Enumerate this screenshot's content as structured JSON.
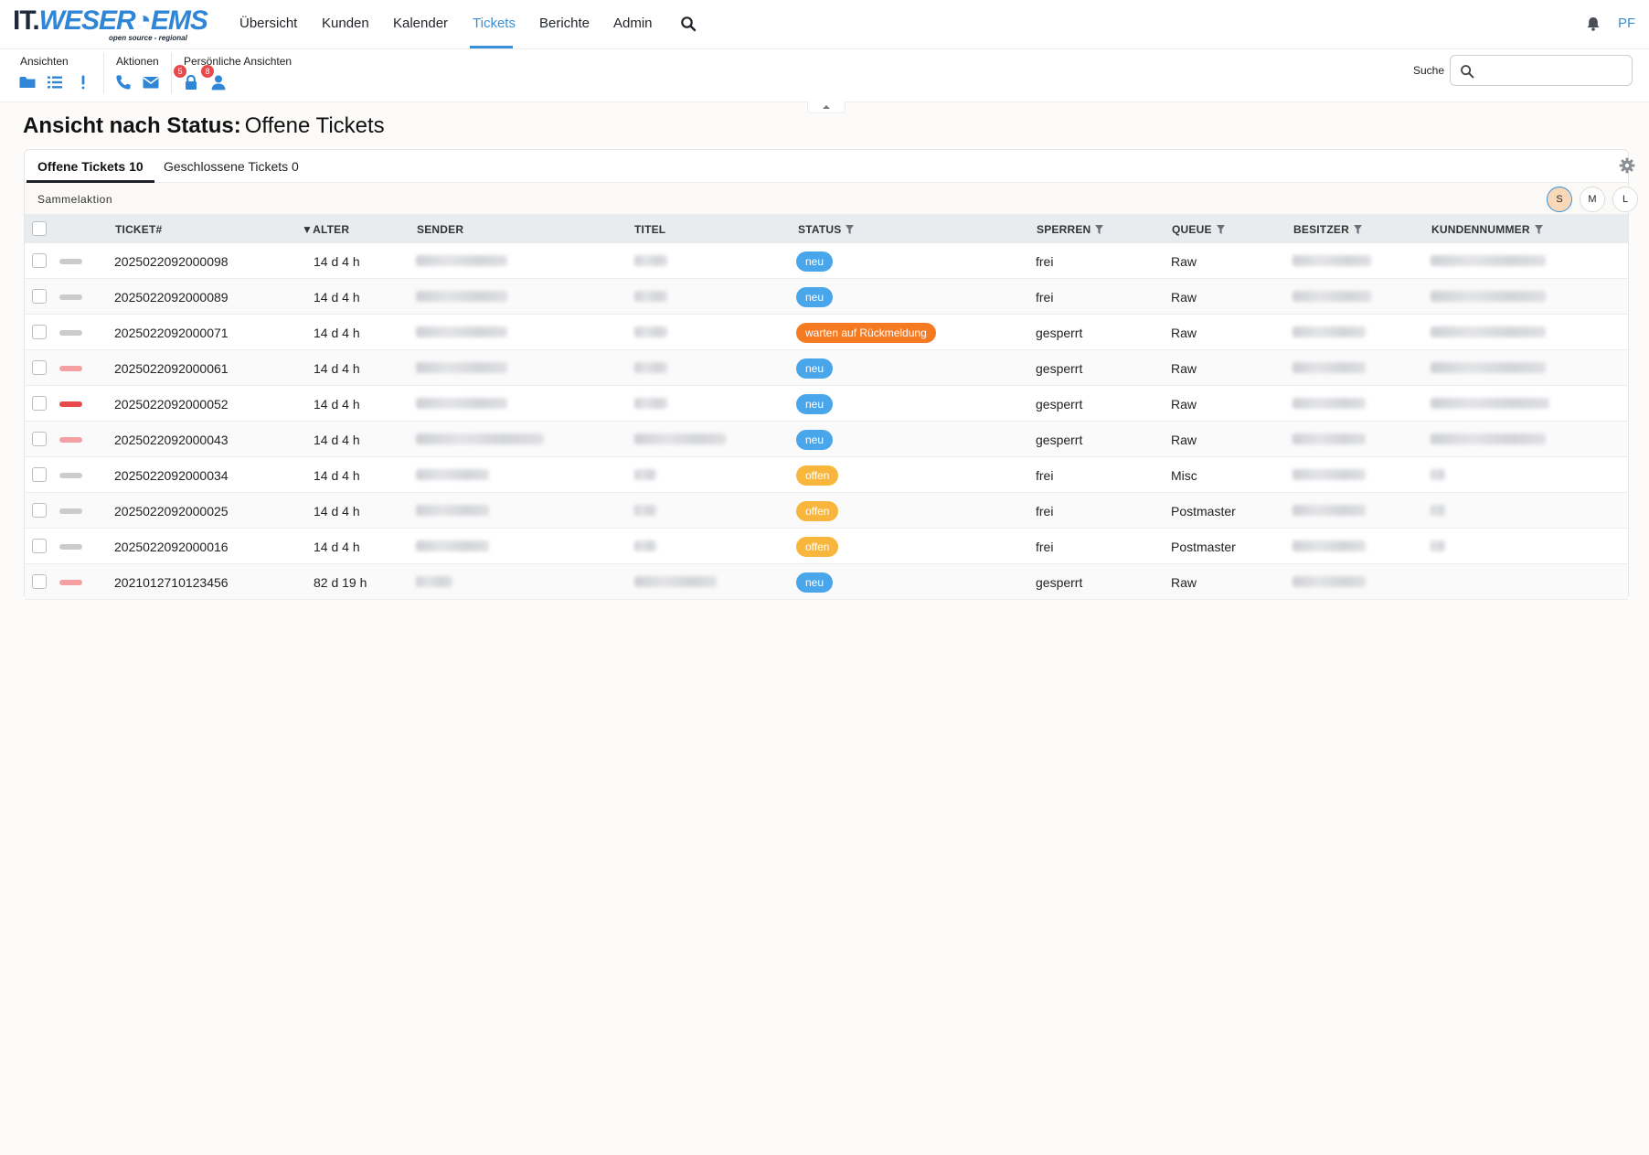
{
  "logo": {
    "part1": "IT.",
    "part2": "WESER",
    "part3": "EMS",
    "tagline": "open source - regional"
  },
  "nav": {
    "items": [
      {
        "label": "Übersicht"
      },
      {
        "label": "Kunden"
      },
      {
        "label": "Kalender"
      },
      {
        "label": "Tickets"
      },
      {
        "label": "Berichte"
      },
      {
        "label": "Admin"
      }
    ],
    "active": "Tickets",
    "search_icon": "search-icon",
    "bell_icon": "bell-icon",
    "user_initials": "PF"
  },
  "toolbar": {
    "views_label": "Ansichten",
    "actions_label": "Aktionen",
    "personal_label": "Persönliche Ansichten",
    "locked_badge": "5",
    "owned_badge": "8",
    "search_label": "Suche",
    "search_value": "",
    "search_placeholder": "",
    "icons": [
      "folder-icon",
      "list-icon",
      "exclamation-icon",
      "phone-icon",
      "envelope-icon",
      "lock-icon",
      "user-icon"
    ]
  },
  "heading": {
    "bold": "Ansicht nach Status:",
    "normal": "Offene Tickets"
  },
  "tabs": [
    {
      "label": "Offene Tickets 10"
    },
    {
      "label": "Geschlossene Tickets 0"
    }
  ],
  "bulk_action_label": "Sammelaktion",
  "size_buttons": [
    "S",
    "M",
    "L"
  ],
  "active_size": "S",
  "columns": [
    "TICKET#",
    "ALTER",
    "SENDER",
    "TITEL",
    "STATUS",
    "SPERREN",
    "QUEUE",
    "BESITZER",
    "KUNDENNUMMER"
  ],
  "sort_indicator": "▼",
  "colors": {
    "accent": "#3a8fd9",
    "status_neu": "#4aa6ea",
    "status_warten": "#f57a22",
    "status_offen": "#f8b73c",
    "prio_normal": "#cccccc",
    "prio_high": "#f4a0a2",
    "prio_very_high": "#e8494b"
  },
  "tickets": [
    {
      "number": "2025022092000098",
      "age": "14 d 4 h",
      "sender": "",
      "title": "",
      "status": "neu",
      "status_type": "neu",
      "lock": "frei",
      "queue": "Raw",
      "owner": "",
      "customer_id": "",
      "priority": "normal"
    },
    {
      "number": "2025022092000089",
      "age": "14 d 4 h",
      "sender": "",
      "title": "",
      "status": "neu",
      "status_type": "neu",
      "lock": "frei",
      "queue": "Raw",
      "owner": "",
      "customer_id": "",
      "priority": "normal"
    },
    {
      "number": "2025022092000071",
      "age": "14 d 4 h",
      "sender": "",
      "title": "",
      "status": "warten auf Rückmeldung",
      "status_type": "warten",
      "lock": "gesperrt",
      "queue": "Raw",
      "owner": "",
      "customer_id": "",
      "priority": "normal"
    },
    {
      "number": "2025022092000061",
      "age": "14 d 4 h",
      "sender": "",
      "title": "",
      "status": "neu",
      "status_type": "neu",
      "lock": "gesperrt",
      "queue": "Raw",
      "owner": "",
      "customer_id": "",
      "priority": "high"
    },
    {
      "number": "2025022092000052",
      "age": "14 d 4 h",
      "sender": "",
      "title": "",
      "status": "neu",
      "status_type": "neu",
      "lock": "gesperrt",
      "queue": "Raw",
      "owner": "",
      "customer_id": "",
      "priority": "very_high"
    },
    {
      "number": "2025022092000043",
      "age": "14 d 4 h",
      "sender": "",
      "title": "",
      "status": "neu",
      "status_type": "neu",
      "lock": "gesperrt",
      "queue": "Raw",
      "owner": "",
      "customer_id": "",
      "priority": "high"
    },
    {
      "number": "2025022092000034",
      "age": "14 d 4 h",
      "sender": "",
      "title": "",
      "status": "offen",
      "status_type": "offen",
      "lock": "frei",
      "queue": "Misc",
      "owner": "",
      "customer_id": "",
      "priority": "normal"
    },
    {
      "number": "2025022092000025",
      "age": "14 d 4 h",
      "sender": "",
      "title": "",
      "status": "offen",
      "status_type": "offen",
      "lock": "frei",
      "queue": "Postmaster",
      "owner": "",
      "customer_id": "",
      "priority": "normal"
    },
    {
      "number": "2025022092000016",
      "age": "14 d 4 h",
      "sender": "",
      "title": "",
      "status": "offen",
      "status_type": "offen",
      "lock": "frei",
      "queue": "Postmaster",
      "owner": "",
      "customer_id": "",
      "priority": "normal"
    },
    {
      "number": "2021012710123456",
      "age": "82 d 19 h",
      "sender": "",
      "title": "",
      "status": "neu",
      "status_type": "neu",
      "lock": "gesperrt",
      "queue": "Raw",
      "owner": "",
      "customer_id": "",
      "priority": "high"
    }
  ]
}
